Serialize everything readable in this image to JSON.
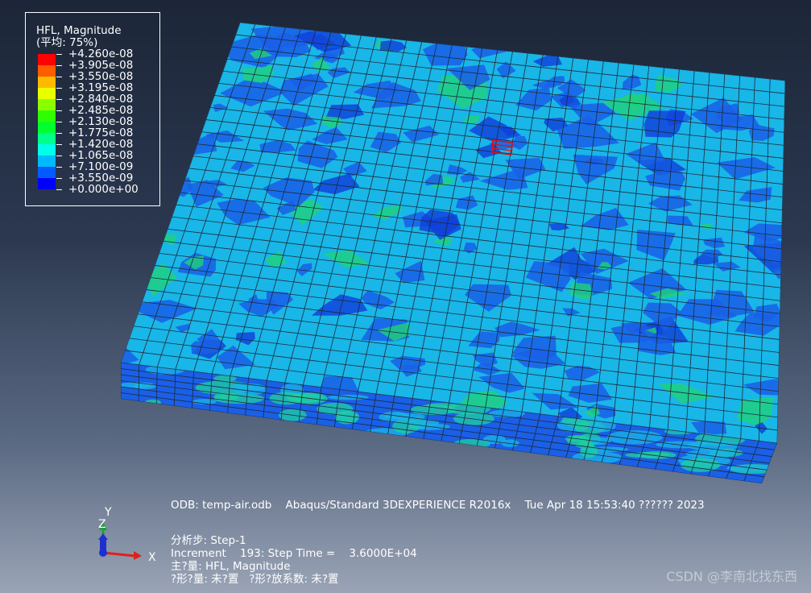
{
  "legend": {
    "title": "HFL, Magnitude",
    "subtitle": "(平均: 75%)",
    "entries": [
      {
        "value": "+4.260e-08",
        "color": "#ff0000"
      },
      {
        "value": "+3.905e-08",
        "color": "#ff5c00"
      },
      {
        "value": "+3.550e-08",
        "color": "#ffb900"
      },
      {
        "value": "+3.195e-08",
        "color": "#e8ff00"
      },
      {
        "value": "+2.840e-08",
        "color": "#8bff00"
      },
      {
        "value": "+2.485e-08",
        "color": "#2eff00"
      },
      {
        "value": "+2.130e-08",
        "color": "#00ff2e"
      },
      {
        "value": "+1.775e-08",
        "color": "#00ff8b"
      },
      {
        "value": "+1.420e-08",
        "color": "#00ffe8"
      },
      {
        "value": "+1.065e-08",
        "color": "#00b9ff"
      },
      {
        "value": "+7.100e-09",
        "color": "#005cff"
      },
      {
        "value": "+3.550e-09",
        "color": "#0000ff"
      },
      {
        "value": "+0.000e+00",
        "color": null
      }
    ]
  },
  "info": {
    "odb": "ODB: temp-air.odb",
    "solver": "Abaqus/Standard 3DEXPERIENCE R2016x",
    "datetime": "Tue Apr 18 15:53:40 ?????? 2023",
    "step": "分析步: Step-1",
    "increment": "Increment    193: Step Time =    3.6000E+04",
    "primary_var": "主?量: HFL, Magnitude",
    "deformed_var": "?形?量: 未?置   ?形?放系数: 未?置"
  },
  "triad": {
    "x_label": "X",
    "y_label": "Y",
    "z_label": "Z",
    "x_color": "#e0201a",
    "y_color": "#1fa03a",
    "z_color": "#2030d0"
  },
  "watermark": "CSDN @李南北找东西",
  "model": {
    "top_mesh_color": "#1e2a3a",
    "low_color": "#1a5fe6",
    "mid_color": "#19b6e8",
    "high_color": "#1fd27a",
    "highlight_color": "#e01010"
  }
}
